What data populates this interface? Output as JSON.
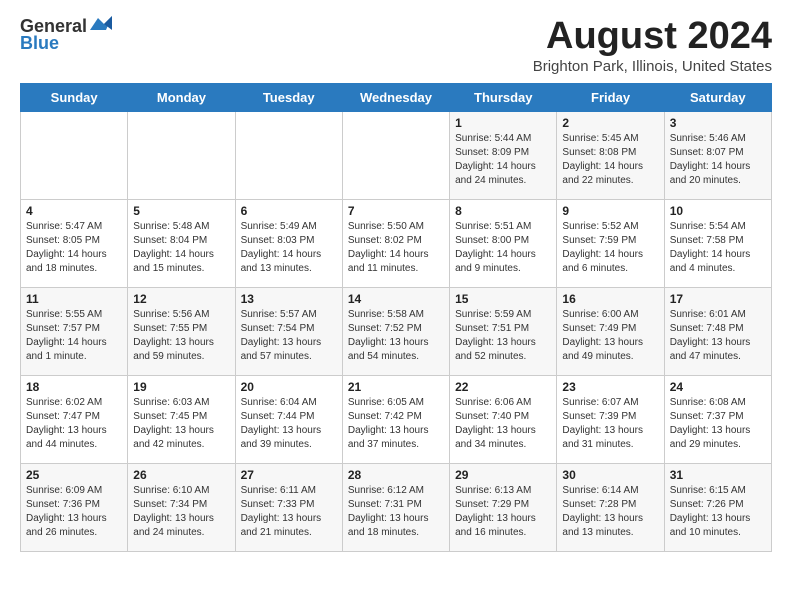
{
  "logo": {
    "general": "General",
    "blue": "Blue"
  },
  "title": "August 2024",
  "subtitle": "Brighton Park, Illinois, United States",
  "weekdays": [
    "Sunday",
    "Monday",
    "Tuesday",
    "Wednesday",
    "Thursday",
    "Friday",
    "Saturday"
  ],
  "weeks": [
    [
      {
        "day": "",
        "detail": ""
      },
      {
        "day": "",
        "detail": ""
      },
      {
        "day": "",
        "detail": ""
      },
      {
        "day": "",
        "detail": ""
      },
      {
        "day": "1",
        "detail": "Sunrise: 5:44 AM\nSunset: 8:09 PM\nDaylight: 14 hours\nand 24 minutes."
      },
      {
        "day": "2",
        "detail": "Sunrise: 5:45 AM\nSunset: 8:08 PM\nDaylight: 14 hours\nand 22 minutes."
      },
      {
        "day": "3",
        "detail": "Sunrise: 5:46 AM\nSunset: 8:07 PM\nDaylight: 14 hours\nand 20 minutes."
      }
    ],
    [
      {
        "day": "4",
        "detail": "Sunrise: 5:47 AM\nSunset: 8:05 PM\nDaylight: 14 hours\nand 18 minutes."
      },
      {
        "day": "5",
        "detail": "Sunrise: 5:48 AM\nSunset: 8:04 PM\nDaylight: 14 hours\nand 15 minutes."
      },
      {
        "day": "6",
        "detail": "Sunrise: 5:49 AM\nSunset: 8:03 PM\nDaylight: 14 hours\nand 13 minutes."
      },
      {
        "day": "7",
        "detail": "Sunrise: 5:50 AM\nSunset: 8:02 PM\nDaylight: 14 hours\nand 11 minutes."
      },
      {
        "day": "8",
        "detail": "Sunrise: 5:51 AM\nSunset: 8:00 PM\nDaylight: 14 hours\nand 9 minutes."
      },
      {
        "day": "9",
        "detail": "Sunrise: 5:52 AM\nSunset: 7:59 PM\nDaylight: 14 hours\nand 6 minutes."
      },
      {
        "day": "10",
        "detail": "Sunrise: 5:54 AM\nSunset: 7:58 PM\nDaylight: 14 hours\nand 4 minutes."
      }
    ],
    [
      {
        "day": "11",
        "detail": "Sunrise: 5:55 AM\nSunset: 7:57 PM\nDaylight: 14 hours\nand 1 minute."
      },
      {
        "day": "12",
        "detail": "Sunrise: 5:56 AM\nSunset: 7:55 PM\nDaylight: 13 hours\nand 59 minutes."
      },
      {
        "day": "13",
        "detail": "Sunrise: 5:57 AM\nSunset: 7:54 PM\nDaylight: 13 hours\nand 57 minutes."
      },
      {
        "day": "14",
        "detail": "Sunrise: 5:58 AM\nSunset: 7:52 PM\nDaylight: 13 hours\nand 54 minutes."
      },
      {
        "day": "15",
        "detail": "Sunrise: 5:59 AM\nSunset: 7:51 PM\nDaylight: 13 hours\nand 52 minutes."
      },
      {
        "day": "16",
        "detail": "Sunrise: 6:00 AM\nSunset: 7:49 PM\nDaylight: 13 hours\nand 49 minutes."
      },
      {
        "day": "17",
        "detail": "Sunrise: 6:01 AM\nSunset: 7:48 PM\nDaylight: 13 hours\nand 47 minutes."
      }
    ],
    [
      {
        "day": "18",
        "detail": "Sunrise: 6:02 AM\nSunset: 7:47 PM\nDaylight: 13 hours\nand 44 minutes."
      },
      {
        "day": "19",
        "detail": "Sunrise: 6:03 AM\nSunset: 7:45 PM\nDaylight: 13 hours\nand 42 minutes."
      },
      {
        "day": "20",
        "detail": "Sunrise: 6:04 AM\nSunset: 7:44 PM\nDaylight: 13 hours\nand 39 minutes."
      },
      {
        "day": "21",
        "detail": "Sunrise: 6:05 AM\nSunset: 7:42 PM\nDaylight: 13 hours\nand 37 minutes."
      },
      {
        "day": "22",
        "detail": "Sunrise: 6:06 AM\nSunset: 7:40 PM\nDaylight: 13 hours\nand 34 minutes."
      },
      {
        "day": "23",
        "detail": "Sunrise: 6:07 AM\nSunset: 7:39 PM\nDaylight: 13 hours\nand 31 minutes."
      },
      {
        "day": "24",
        "detail": "Sunrise: 6:08 AM\nSunset: 7:37 PM\nDaylight: 13 hours\nand 29 minutes."
      }
    ],
    [
      {
        "day": "25",
        "detail": "Sunrise: 6:09 AM\nSunset: 7:36 PM\nDaylight: 13 hours\nand 26 minutes."
      },
      {
        "day": "26",
        "detail": "Sunrise: 6:10 AM\nSunset: 7:34 PM\nDaylight: 13 hours\nand 24 minutes."
      },
      {
        "day": "27",
        "detail": "Sunrise: 6:11 AM\nSunset: 7:33 PM\nDaylight: 13 hours\nand 21 minutes."
      },
      {
        "day": "28",
        "detail": "Sunrise: 6:12 AM\nSunset: 7:31 PM\nDaylight: 13 hours\nand 18 minutes."
      },
      {
        "day": "29",
        "detail": "Sunrise: 6:13 AM\nSunset: 7:29 PM\nDaylight: 13 hours\nand 16 minutes."
      },
      {
        "day": "30",
        "detail": "Sunrise: 6:14 AM\nSunset: 7:28 PM\nDaylight: 13 hours\nand 13 minutes."
      },
      {
        "day": "31",
        "detail": "Sunrise: 6:15 AM\nSunset: 7:26 PM\nDaylight: 13 hours\nand 10 minutes."
      }
    ]
  ]
}
